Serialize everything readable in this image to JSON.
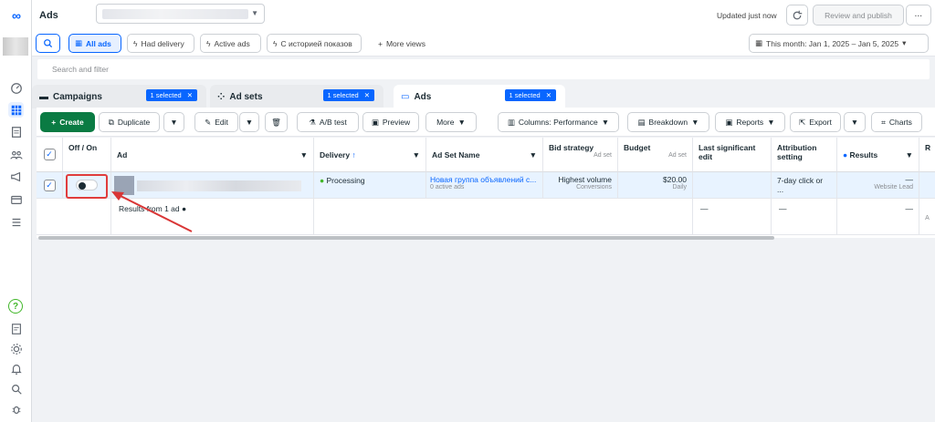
{
  "header": {
    "title": "Ads",
    "updated": "Updated just now",
    "review_publish": "Review and publish",
    "more": "···"
  },
  "chips": {
    "all_ads": "All ads",
    "had_delivery": "Had delivery",
    "active_ads": "Active ads",
    "history": "С историей показов",
    "more_views": "More views",
    "date_range": "This month: Jan 1, 2025 – Jan 5, 2025"
  },
  "search": {
    "placeholder": "Search and filter"
  },
  "tabs": [
    {
      "label": "Campaigns",
      "badge": "1 selected"
    },
    {
      "label": "Ad sets",
      "badge": "1 selected"
    },
    {
      "label": "Ads",
      "badge": "1 selected"
    }
  ],
  "toolbar": {
    "create": "Create",
    "duplicate": "Duplicate",
    "edit": "Edit",
    "ab_test": "A/B test",
    "preview": "Preview",
    "more": "More",
    "columns": "Columns: Performance",
    "breakdown": "Breakdown",
    "reports": "Reports",
    "export": "Export",
    "charts": "Charts"
  },
  "columns": {
    "offon": "Off / On",
    "ad": "Ad",
    "delivery": "Delivery",
    "delivery_sort": "↑",
    "adset_name": "Ad Set Name",
    "bid_strategy": "Bid strategy",
    "bid_sub": "Ad set",
    "budget": "Budget",
    "budget_sub": "Ad set",
    "last_edit": "Last significant edit",
    "attribution": "Attribution setting",
    "results": "Results",
    "next": "R"
  },
  "row": {
    "delivery": "Processing",
    "adset_name": "Новая группа объявлений с...",
    "adset_sub": "0 active ads",
    "bid": "Highest volume",
    "bid_sub": "Conversions",
    "budget": "$20.00",
    "budget_sub": "Daily",
    "attribution": "7-day click or ...",
    "results": "—",
    "results_sub": "Website Lead"
  },
  "summary": {
    "label": "Results from 1 ad",
    "dash": "—",
    "a": "A"
  },
  "colors": {
    "accent": "#0866ff",
    "create_green": "#0a7b43",
    "row_selected": "#e8f3ff",
    "highlight_red": "#e03d3d",
    "processing_green": "#42b72a"
  },
  "icons": [
    "meta-logo-icon",
    "dashboard-icon",
    "table-icon",
    "pages-icon",
    "audience-icon",
    "megaphone-icon",
    "billing-icon",
    "menu-icon",
    "help-icon",
    "report-icon",
    "gear-icon",
    "bell-icon",
    "search-icon",
    "bug-icon"
  ]
}
